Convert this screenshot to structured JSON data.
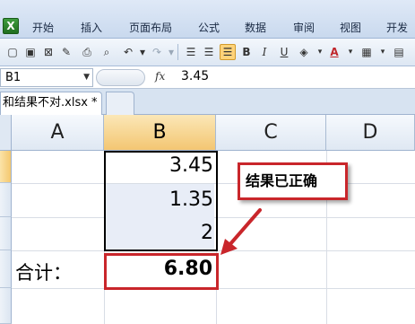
{
  "ribbon": {
    "app_icon_letter": "X",
    "tabs": [
      "开始",
      "插入",
      "页面布局",
      "公式",
      "数据",
      "审阅",
      "视图",
      "开发"
    ]
  },
  "toolbar": {
    "icons": [
      "new-icon",
      "save-icon",
      "print-preview-icon",
      "format-painter-icon",
      "print-icon",
      "preview-icon",
      "undo-icon",
      "redo-icon",
      "align-left-icon",
      "align-center-icon",
      "align-right-icon",
      "bold-icon",
      "italic-icon",
      "underline-icon",
      "fill-color-icon",
      "font-color-icon",
      "borders-icon",
      "more-icon"
    ],
    "bold": "B",
    "italic": "I",
    "underline": "U",
    "font_color_letter": "A",
    "accent": "#ffd37a"
  },
  "formula_bar": {
    "name_box": "B1",
    "fx": "fx",
    "value": "3.45"
  },
  "workbook": {
    "tab_label": "和结果不对.xlsx *"
  },
  "sheet": {
    "columns": [
      "A",
      "B",
      "C",
      "D"
    ],
    "selected_column": "B",
    "cells_b": [
      "3.45",
      "1.35",
      "2"
    ],
    "sum_label": "合计：",
    "sum_value": "6.80"
  },
  "annotation": {
    "callout_text": "结果已正确",
    "color": "#c9262b"
  }
}
